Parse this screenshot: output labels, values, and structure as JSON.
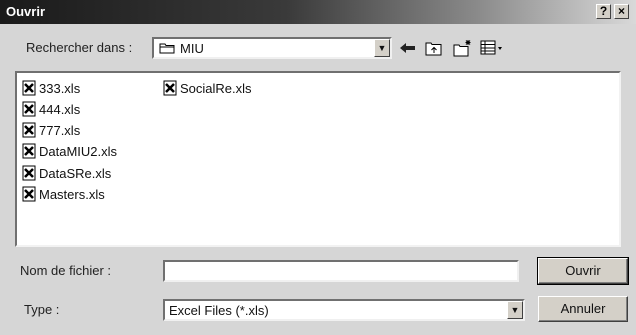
{
  "window": {
    "title": "Ouvrir",
    "help_button": "?",
    "close_button": "×"
  },
  "lookin": {
    "label": "Rechercher dans :",
    "value": "MIU"
  },
  "files": {
    "column1": [
      "333.xls",
      "444.xls",
      "777.xls",
      "DataMIU2.xls",
      "DataSRe.xls",
      "Masters.xls"
    ],
    "column2": [
      "SocialRe.xls"
    ]
  },
  "filename": {
    "label": "Nom de fichier :",
    "value": ""
  },
  "filetype": {
    "label": "Type :",
    "value": "Excel Files (*.xls)"
  },
  "buttons": {
    "open": "Ouvrir",
    "cancel": "Annuler"
  }
}
